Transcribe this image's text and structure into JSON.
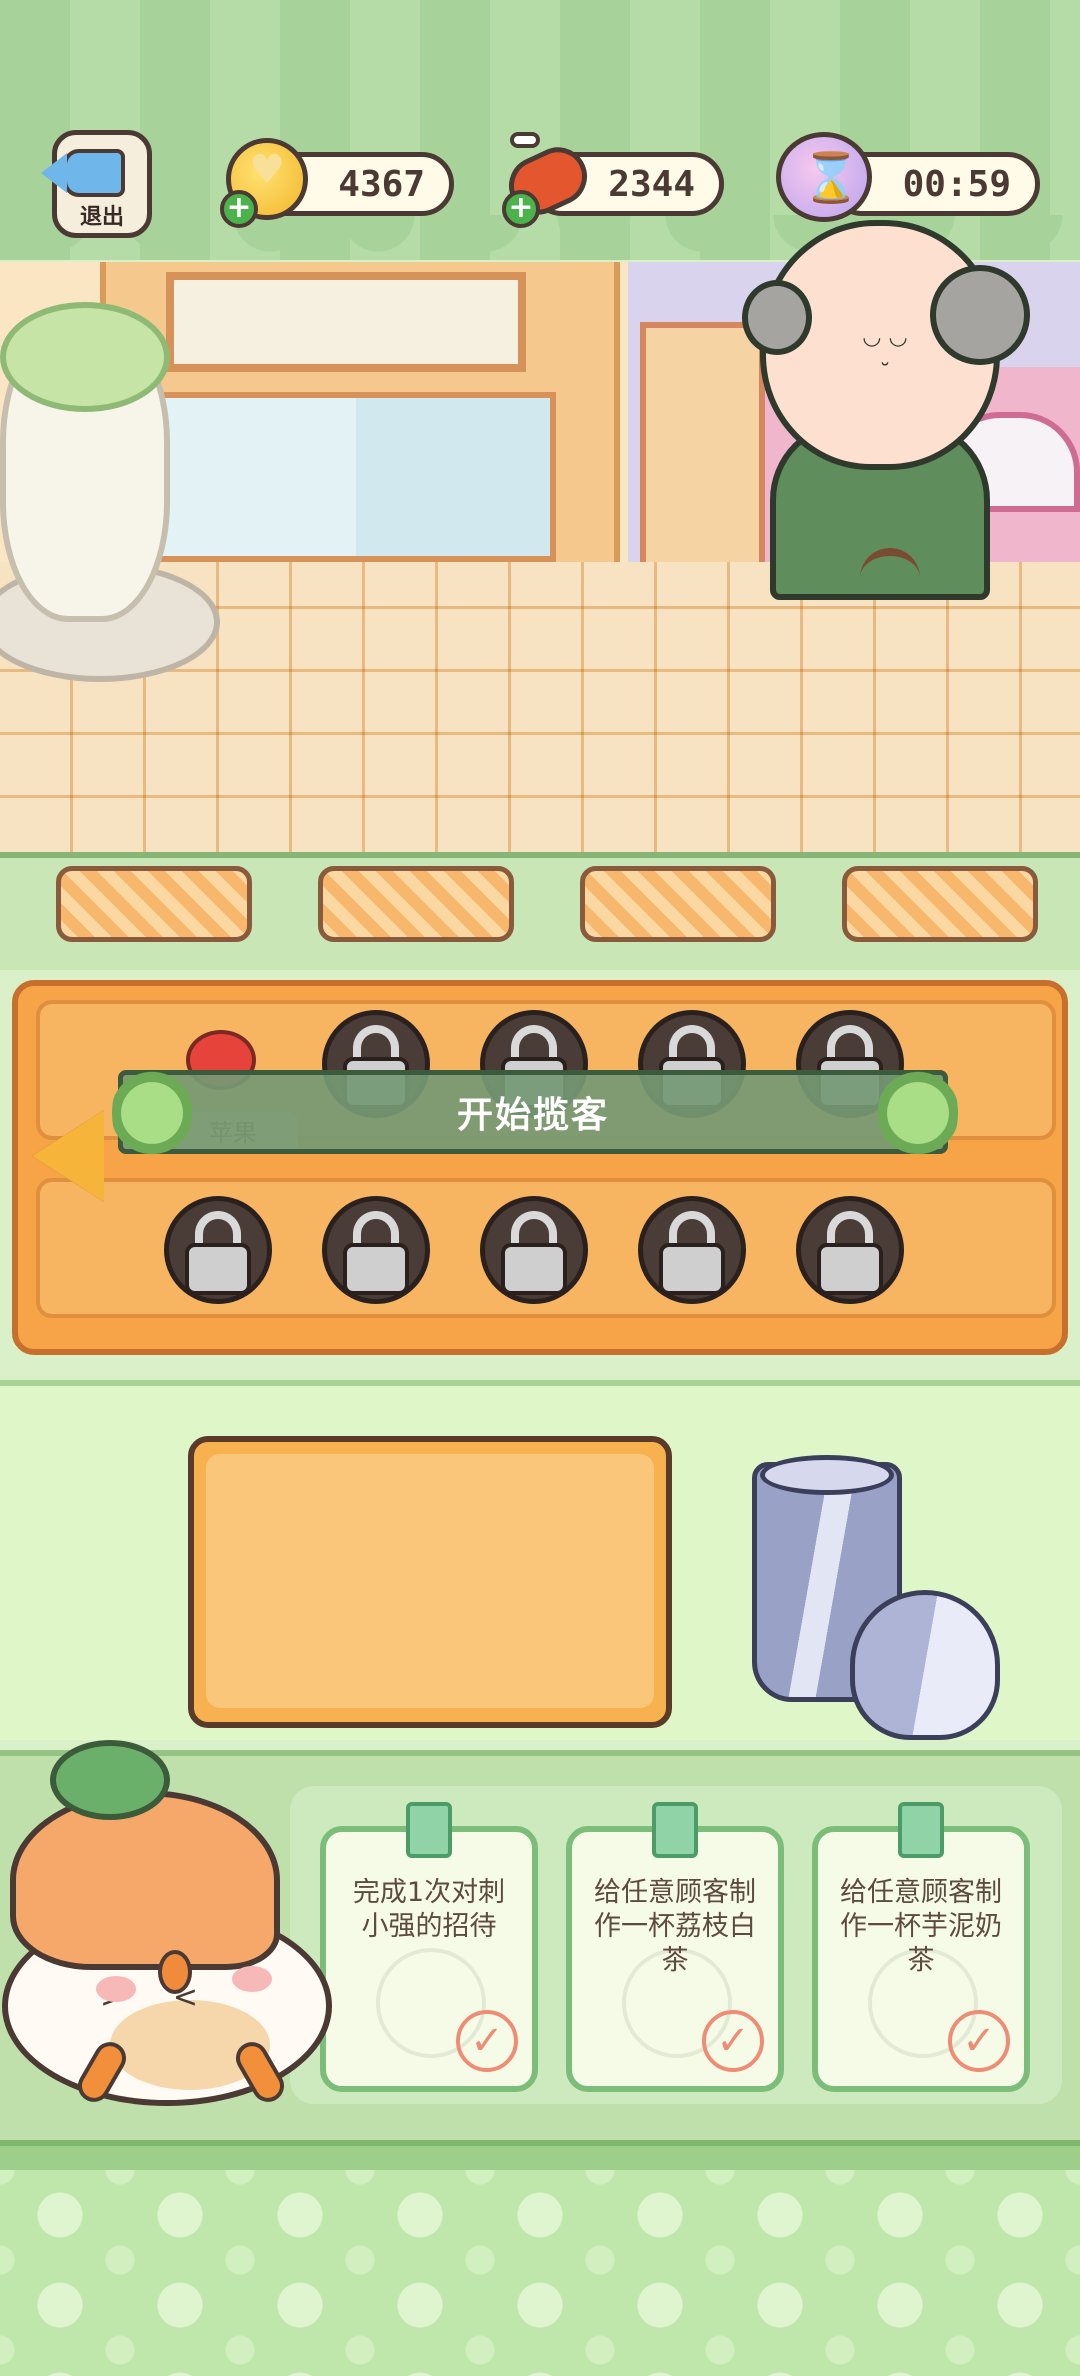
{
  "hud": {
    "exit_label": "退出",
    "coins": "4367",
    "food": "2344",
    "timer": "00:59",
    "icons": [
      "back-arrow-icon",
      "coin-heart-icon",
      "meat-icon",
      "hourglass-timer-icon"
    ]
  },
  "shelf": {
    "first_item_label": "苹果",
    "banner_text": "开始揽客"
  },
  "tasks": [
    {
      "text": "完成1次对刺小强的招待"
    },
    {
      "text": "给任意顾客制作一杯荔枝白茶"
    },
    {
      "text": "给任意顾客制作一杯芋泥奶茶"
    }
  ],
  "colors": {
    "hud_green": "#a7d39a",
    "shelf_orange": "#f6a447",
    "banner_green": "#759974",
    "task_border": "#7dbd7a",
    "check_color": "#ef8c74"
  }
}
